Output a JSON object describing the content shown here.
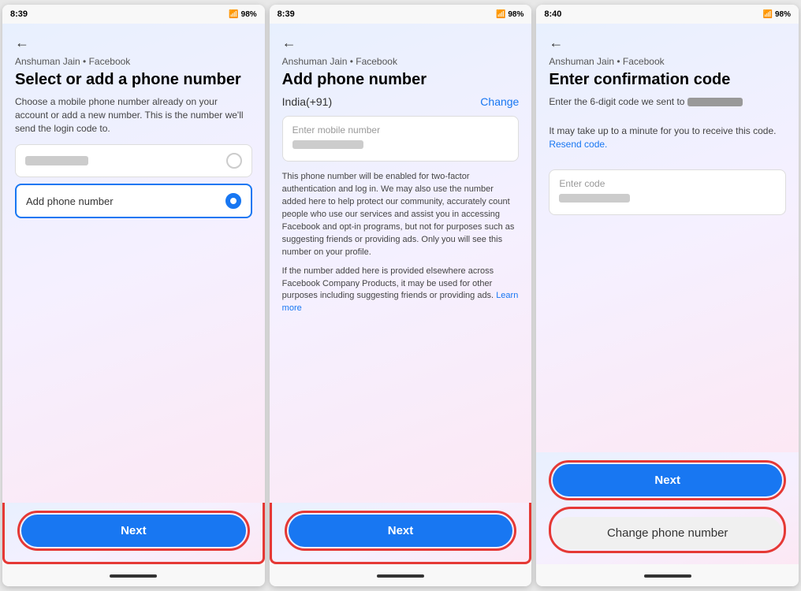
{
  "screens": [
    {
      "id": "screen1",
      "time": "8:39",
      "battery": "98%",
      "account": "Anshuman Jain • Facebook",
      "title": "Select or add a phone number",
      "desc": "Choose a mobile phone number already on your account or add a new number. This is the number we'll send the login code to.",
      "options": [
        {
          "id": "existing",
          "label": "",
          "selected": false
        },
        {
          "id": "add",
          "label": "Add phone number",
          "selected": true
        }
      ],
      "next_label": "Next"
    },
    {
      "id": "screen2",
      "time": "8:39",
      "battery": "98%",
      "account": "Anshuman Jain • Facebook",
      "title": "Add phone number",
      "country": "India(+91)",
      "change_link": "Change",
      "input_placeholder": "Enter mobile number",
      "info1": "This phone number will be enabled for two-factor authentication and log in. We may also use the number added here to help protect our community, accurately count people who use our services and assist you in accessing Facebook and opt-in programs, but not for purposes such as suggesting friends or providing ads. Only you will see this number on your profile.",
      "info2": "If the number added here is provided elsewhere across Facebook Company Products, it may be used for other purposes including suggesting friends or providing ads.",
      "learn_more": "Learn more",
      "next_label": "Next"
    },
    {
      "id": "screen3",
      "time": "8:40",
      "battery": "98%",
      "account": "Anshuman Jain • Facebook",
      "title": "Enter confirmation code",
      "desc_prefix": "Enter the 6-digit code we sent to",
      "desc2": "It may take up to a minute for you to receive this code.",
      "resend_label": "Resend code.",
      "input_placeholder": "Enter code",
      "next_label": "Next",
      "change_phone_label": "Change phone number"
    }
  ]
}
